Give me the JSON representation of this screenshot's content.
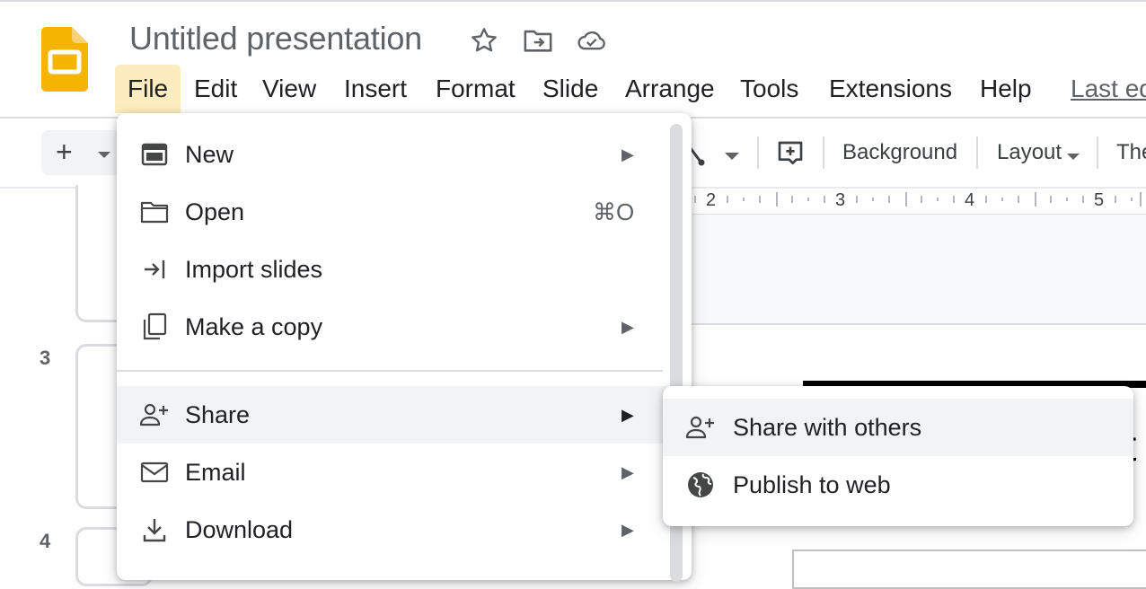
{
  "app": {
    "title": "Untitled presentation",
    "brand_color": "#f4b400"
  },
  "menubar": {
    "items": [
      "File",
      "Edit",
      "View",
      "Insert",
      "Format",
      "Slide",
      "Arrange",
      "Tools",
      "Extensions",
      "Help"
    ],
    "last_edit": "Last ed"
  },
  "toolbar": {
    "add_label": "+",
    "background_label": "Background",
    "layout_label": "Layout",
    "theme_label": "The"
  },
  "ruler": {
    "marks": [
      "2",
      "3",
      "4",
      "5"
    ]
  },
  "filmstrip": {
    "slide_numbers": [
      "3",
      "4"
    ]
  },
  "slide": {
    "text_fragment": "t"
  },
  "file_menu": {
    "items": [
      {
        "label": "New",
        "icon": "new-presentation-icon",
        "submenu": true
      },
      {
        "label": "Open",
        "icon": "folder-icon",
        "shortcut": "⌘O"
      },
      {
        "label": "Import slides",
        "icon": "import-icon"
      },
      {
        "label": "Make a copy",
        "icon": "copy-icon",
        "submenu": true
      },
      {
        "label": "Share",
        "icon": "person-add-icon",
        "submenu": true
      },
      {
        "label": "Email",
        "icon": "mail-icon",
        "submenu": true
      },
      {
        "label": "Download",
        "icon": "download-icon",
        "submenu": true
      }
    ]
  },
  "share_submenu": {
    "items": [
      {
        "label": "Share with others",
        "icon": "person-add-icon"
      },
      {
        "label": "Publish to web",
        "icon": "globe-icon"
      }
    ]
  },
  "colors": {
    "active_menu_bg": "#fdecbd",
    "hover_bg": "#f1f3f4",
    "text": "#202124",
    "muted": "#5f6368"
  }
}
